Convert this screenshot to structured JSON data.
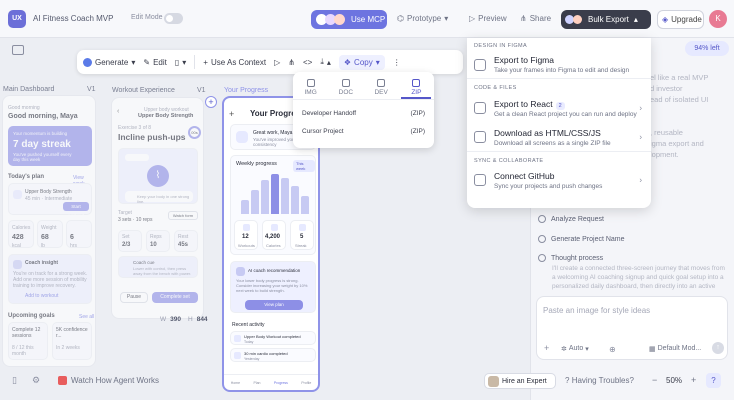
{
  "header": {
    "logo": "UX",
    "project_title": "AI Fitness Coach MVP",
    "edit_mode_label": "Edit Mode",
    "use_mcp": "Use MCP",
    "prototype": "Prototype",
    "preview": "Preview",
    "share": "Share",
    "bulk_export": "Bulk Export",
    "upgrade": "Upgrade",
    "avatar_initial": "K"
  },
  "toolbar": {
    "generate": "Generate",
    "edit": "Edit",
    "use_as_context": "Use As Context",
    "copy": "Copy"
  },
  "screens": {
    "s1": {
      "label": "Main Dashboard",
      "label_right": "V1",
      "greeting_small": "Good morning",
      "greeting": "Good morning, Maya",
      "streak_small": "Your momentum is building",
      "streak": "7 day streak",
      "streak_sub": "You've pushed yourself every day this week",
      "todays_plan": "Today's plan",
      "view_week": "View week",
      "workout_title": "Upper Body Strength",
      "workout_sub": "45 min · Intermediate",
      "start_workout": "Start workout",
      "stat1_label": "Calories",
      "stat1_value": "428",
      "stat1_unit": "kcal",
      "stat2_label": "Weight",
      "stat2_value": "68",
      "stat2_unit": "lb",
      "stat3_value": "6",
      "stat3_unit": "hrs",
      "coach_title": "Coach insight",
      "coach_text": "You're on track for a strong week. Add one more session of mobility training to improve recovery.",
      "coach_link": "Add to workout",
      "upcoming": "Upcoming goals",
      "see_all": "See all",
      "goal1_title": "Complete 12 sessions",
      "goal1_sub": "8 / 12 this month",
      "goal2_title": "5K confidence r...",
      "goal2_sub": "In 2 weeks"
    },
    "s2": {
      "label": "Workout Experience",
      "label_right": "V1",
      "header_small": "Upper body workout",
      "header_title": "Upper Body Strength",
      "exercise_small": "Exercise 3 of 8",
      "exercise": "Incline push-ups",
      "timer": "00s",
      "coach_text": "Keep your body in one strong line.",
      "target_label": "Target",
      "target_value": "3 sets · 10 reps",
      "watch_form": "Watch form",
      "set_label": "Set",
      "set_value": "2/3",
      "reps_label": "Reps",
      "reps_value": "10",
      "rest_label": "Rest",
      "rest_value": "45s",
      "coach_cue_title": "Coach cue",
      "coach_cue_text": "Lower with control, then press away from the bench with power.",
      "pause": "Pause",
      "complete_set": "Complete set",
      "dim_w_label": "W",
      "dim_w": "390",
      "dim_h_label": "H",
      "dim_h": "844"
    },
    "s3": {
      "label": "Your Progress",
      "label_right": "V1",
      "title": "Your Progress",
      "great_work": "Great work, Maya",
      "great_sub": "You've improved your consistency",
      "weekly_progress": "Weekly progress",
      "weekly_range": "This week",
      "stat1_value": "12",
      "stat1_label": "Workouts",
      "stat2_value": "4,200",
      "stat2_label": "Calories",
      "stat3_value": "5",
      "stat3_label": "Streak",
      "ai_title": "AI coach recommendation",
      "ai_text": "Your lower body progress is strong. Consider increasing your weight by 10% next week to build strength.",
      "view_plan": "View plan",
      "recent_activity": "Recent activity",
      "act1": "Upper Body Workout completed",
      "act1_sub": "Today",
      "act2": "30 min cardio completed",
      "act2_sub": "Yesterday",
      "nav": [
        "Home",
        "Plan",
        "Progress",
        "Profile"
      ]
    }
  },
  "export_mini": {
    "tabs": [
      "IMG",
      "DOC",
      "DEV",
      "ZIP"
    ],
    "active_tab": "ZIP",
    "rows": [
      {
        "label": "Developer Handoff",
        "tag": "(ZIP)"
      },
      {
        "label": "Cursor Project",
        "tag": "(ZIP)"
      }
    ]
  },
  "export_menu": {
    "section1": "DESIGN IN FIGMA",
    "figma_title": "Export to Figma",
    "figma_desc": "Take your frames into Figma to edit and design",
    "section2": "CODE & FILES",
    "react_title": "Export to React",
    "react_badge": "2",
    "react_desc": "Get a clean React project you can run and deploy",
    "html_title": "Download as HTML/CSS/JS",
    "html_desc": "Download all screens as a single ZIP file",
    "section3": "SYNC & COLLABORATE",
    "github_title": "Connect GitHub",
    "github_desc": "Sync your projects and push changes"
  },
  "chat": {
    "credits": "94% left",
    "text_lines": [
      "el like a real MVP",
      "d investor",
      "ead of isolated UI",
      "",
      ", reusable",
      "igma export and",
      "lopment."
    ],
    "steps": [
      "Analyze Request",
      "Generate Project Name",
      "Thought process"
    ],
    "thought": "I'll create a connected three-screen journey that moves from a welcoming AI coaching signup and quick goal setup into a personalized daily dashboard, then directly into an active",
    "input_placeholder": "Paste an image for style ideas",
    "auto": "Auto",
    "model": "Default Mod..."
  },
  "bottom": {
    "watch": "Watch How Agent Works",
    "hire": "Hire an Expert",
    "trouble": "Having Troubles?",
    "zoom": "50%",
    "help": "?"
  }
}
